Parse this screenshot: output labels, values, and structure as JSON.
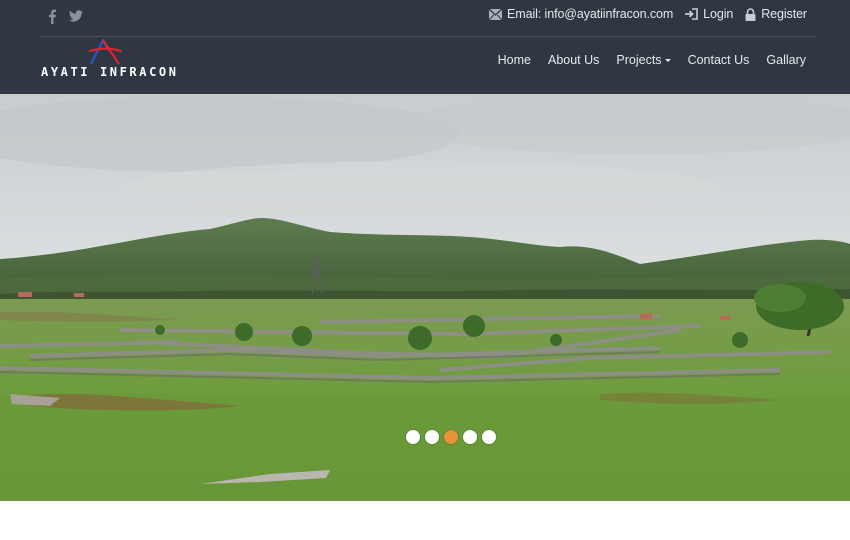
{
  "social": [
    {
      "name": "facebook-icon",
      "glyph": "f"
    },
    {
      "name": "twitter-icon",
      "glyph": "t"
    }
  ],
  "topbar": {
    "email_label": "Email: info@ayatiinfracon.com",
    "login_label": "Login",
    "register_label": "Register"
  },
  "logo": {
    "text": "AYATI INFRACON",
    "colors": {
      "red": "#e0242f",
      "blue": "#2a56c6"
    }
  },
  "nav": {
    "items": [
      {
        "label": "Home"
      },
      {
        "label": "About Us"
      },
      {
        "label": "Projects",
        "dropdown": true
      },
      {
        "label": "Contact Us"
      },
      {
        "label": "Gallary"
      }
    ]
  },
  "hero": {
    "slide_count": 5,
    "active_slide": 3
  },
  "colors": {
    "header_bg": "#2f3742",
    "accent": "#e8923a"
  }
}
